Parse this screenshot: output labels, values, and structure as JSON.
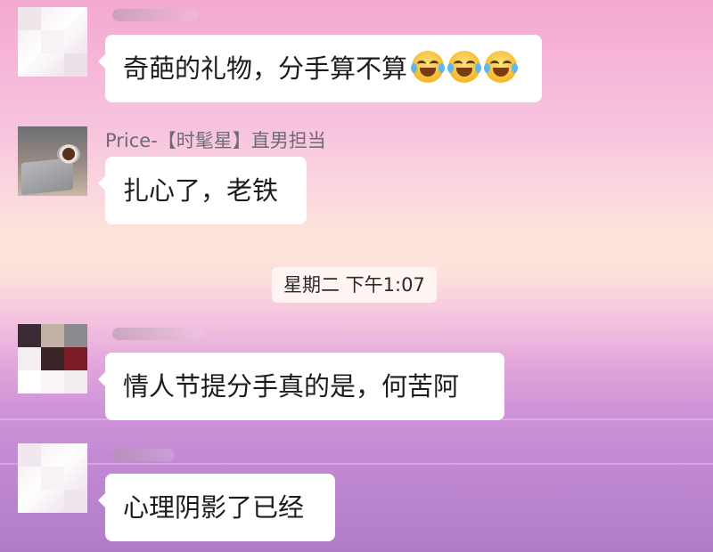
{
  "messages": [
    {
      "text": "奇葩的礼物，分手算不算",
      "emoji": [
        "joy-tears-emoji",
        "joy-tears-emoji",
        "joy-tears-emoji"
      ]
    },
    {
      "sender": "Price-【时髦星】直男担当",
      "text": "扎心了，老铁"
    },
    {
      "text": "情人节提分手真的是，何苦阿"
    },
    {
      "text": "心理阴影了已经"
    }
  ],
  "timestamp": "星期二 下午1:07",
  "colors": {
    "bubble": "#ffffff",
    "sender_name": "#6f6a74",
    "timestamp_bg": "#fff6f2"
  }
}
